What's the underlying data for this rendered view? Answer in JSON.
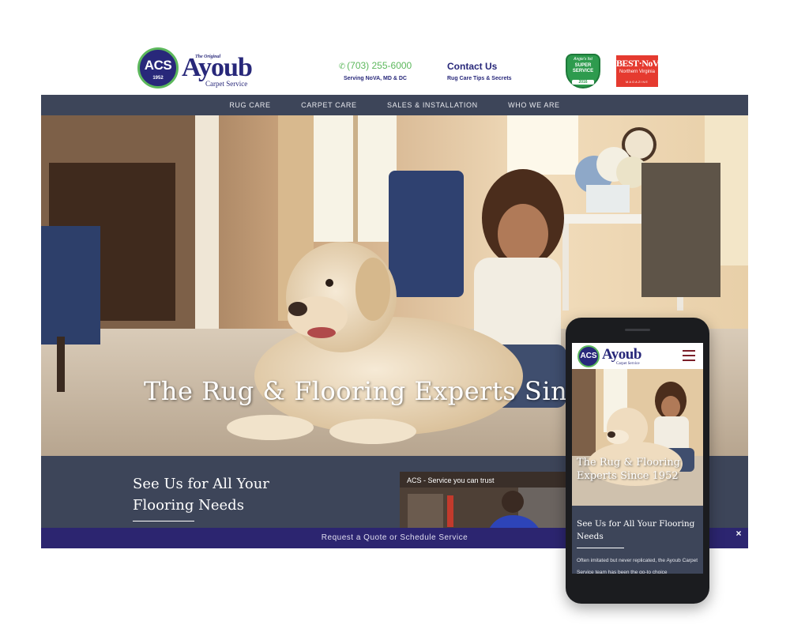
{
  "header": {
    "logo": {
      "seal_text": "ACS",
      "seal_year": "1952",
      "pretitle": "The Original",
      "name": "Ayoub",
      "tagline": "Carpet Service"
    },
    "phone": {
      "icon": "phone-icon",
      "number": "(703) 255-6000",
      "subtitle": "Serving NoVA, MD & DC"
    },
    "contact": {
      "title": "Contact Us",
      "subtitle": "Rug Care Tips & Secrets"
    },
    "badges": {
      "super_service": {
        "line1": "Angie's list",
        "line2": "SUPER SERVICE",
        "line3": "AWARD",
        "year": "2016"
      },
      "best_of_nova": {
        "line1": "BEST·NoVA",
        "line2": "Northern Virginia",
        "line3": "MAGAZINE"
      }
    }
  },
  "nav": {
    "items": [
      {
        "label": "RUG CARE"
      },
      {
        "label": "CARPET CARE"
      },
      {
        "label": "SALES & INSTALLATION"
      },
      {
        "label": "WHO WE ARE"
      }
    ]
  },
  "hero": {
    "title": "The Rug & Flooring Experts Since 1952"
  },
  "section": {
    "title": "See Us for All Your Flooring Needs",
    "video_caption": "ACS - Service you can trust"
  },
  "cta": {
    "label": "Request a Quote or Schedule Service",
    "close_icon": "×"
  },
  "mobile": {
    "seal_text": "ACS",
    "name": "Ayoub",
    "tagline": "Carpet Service",
    "menu_icon": "hamburger-icon",
    "hero_title": "The Rug & Flooring Experts Since 1952",
    "section_title": "See Us for All Your Flooring Needs",
    "body": "Often imitated but never replicated, the Ayoub Carpet Service team has been the go-to choice"
  },
  "colors": {
    "brand_navy": "#28287a",
    "brand_green": "#5cb85c",
    "nav_bg": "#3d4559",
    "cta_bg": "#2c2570",
    "badge_red": "#e53a2f"
  }
}
